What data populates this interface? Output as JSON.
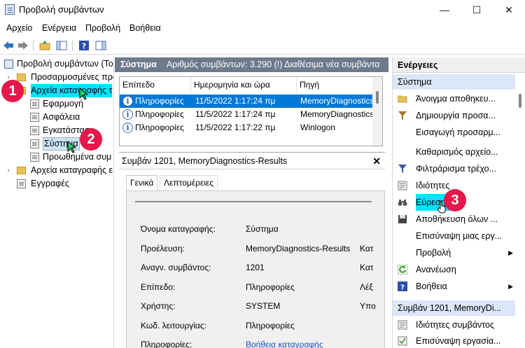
{
  "window": {
    "title": "Προβολή συμβάντων"
  },
  "menu": [
    "Αρχείο",
    "Ενέργεια",
    "Προβολή",
    "Βοήθεια"
  ],
  "tree": {
    "root": "Προβολή συμβάντων (Το",
    "custom_views": "Προσαρμοσμένες προ",
    "windows_logs": "Αρχεία καταγραφής τ",
    "application": "Εφαρμογή",
    "security": "Ασφάλεια",
    "setup": "Εγκατάσταση",
    "system": "Σύστημα",
    "forwarded": "Προωθημένα συμ",
    "apps_services": "Αρχεία καταγραφής ε",
    "subscriptions": "Εγγραφές"
  },
  "middle": {
    "header_name": "Σύστημα",
    "header_info": "Αριθμός συμβάντων: 3.290 (!) Διαθέσιμα νέα συμβάντα",
    "columns": [
      "Επίπεδο",
      "Ημερομηνία και ώρα",
      "Πηγή"
    ],
    "rows": [
      {
        "level": "Πληροφορίες",
        "datetime": "11/5/2022 1:17:24 πμ",
        "source": "MemoryDiagnostics",
        "selected": true
      },
      {
        "level": "Πληροφορίες",
        "datetime": "11/5/2022 1:17:24 πμ",
        "source": "MemoryDiagnostics.",
        "selected": false
      },
      {
        "level": "Πληροφορίες",
        "datetime": "11/5/2022 1:17:22 πμ",
        "source": "Winlogon",
        "selected": false
      }
    ],
    "detail_title": "Συμβάν 1201, MemoryDiagnostics-Results",
    "tabs": [
      "Γενικά",
      "Λεπτομέρειες"
    ],
    "props": [
      {
        "label": "Όνομα καταγραφής:",
        "value": "Σύστημα",
        "extra": ""
      },
      {
        "label": "Προέλευση:",
        "value": "MemoryDiagnostics-Results",
        "extra": "Κατ"
      },
      {
        "label": "Αναγν. συμβάντος:",
        "value": "1201",
        "extra": "Κατ"
      },
      {
        "label": "Επίπεδο:",
        "value": "Πληροφορίες",
        "extra": "Λέξ"
      },
      {
        "label": "Χρήστης:",
        "value": "SYSTEM",
        "extra": "Υπο"
      },
      {
        "label": "Κωδ. λειτουργίας:",
        "value": "Πληροφορίες",
        "extra": ""
      },
      {
        "label": "Πληροφορίες:",
        "value": "Βοήθεια καταγραφής",
        "extra": ""
      }
    ]
  },
  "actions": {
    "title": "Ενέργειες",
    "section1": "Σύστημα",
    "items": [
      "Άνοιγμα αποθηκευ...",
      "Δημιουργία προσα...",
      "Εισαγωγή προσαρμ...",
      "Καθαρισμός αρχείο...",
      "Φιλτράρισμα τρέχο...",
      "Ιδιότητες",
      "Εύρεση...",
      "Αποθήκευση όλων ...",
      "Επισύναψη μιας εργ...",
      "Προβολή",
      "Ανανέωση",
      "Βοήθεια"
    ],
    "section2": "Συμβάν 1201, MemoryDi...",
    "items2": [
      "Ιδιότητες συμβάντος",
      "Επισύναψη εργασία..."
    ]
  },
  "badges": [
    "1",
    "2",
    "3"
  ],
  "colors": {
    "selection": "#0078d7",
    "highlight": "#00e5ff",
    "badge": "#e6174b",
    "header": "#6d7a8c"
  }
}
